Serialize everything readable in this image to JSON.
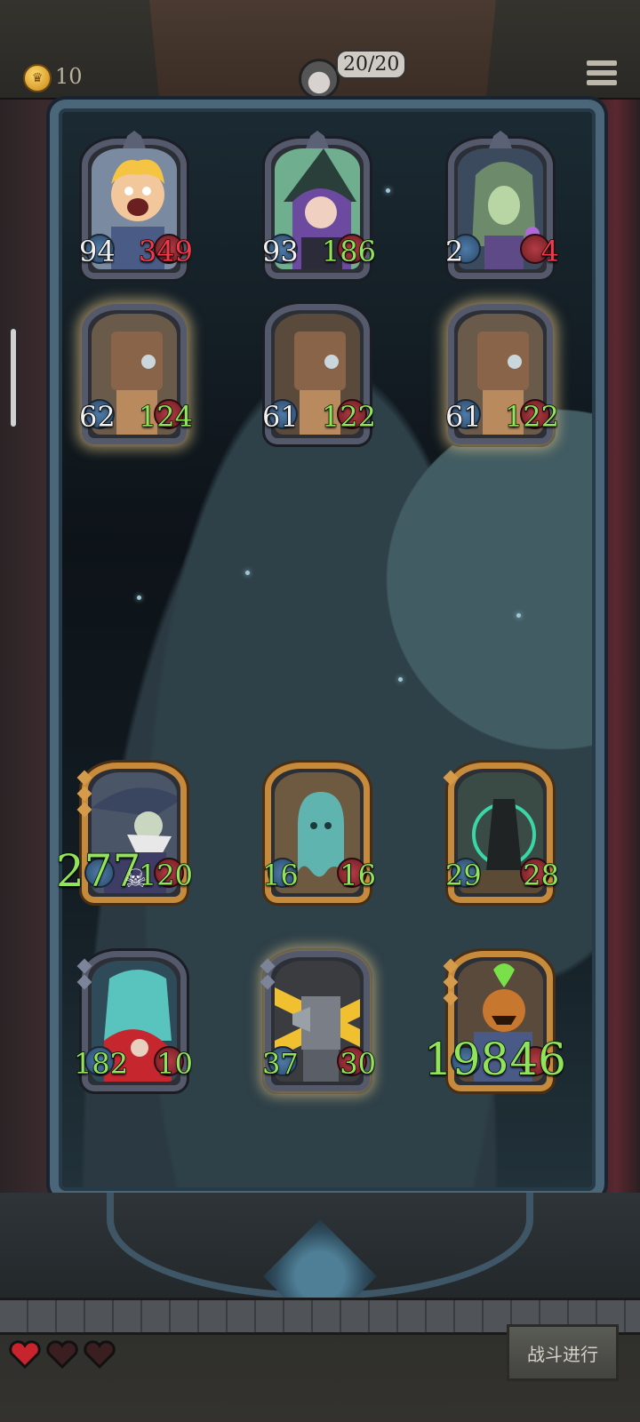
{
  "header": {
    "coins": "10",
    "energy": "20/20",
    "coin_icon": "crown-coin-icon",
    "menu_icon": "hamburger-menu-icon"
  },
  "player_cards": [
    {
      "name": "blonde-boy",
      "attack": "94",
      "health": "349",
      "health_color": "red",
      "glow": false
    },
    {
      "name": "witch",
      "attack": "93",
      "health": "186",
      "health_color": "green",
      "glow": false
    },
    {
      "name": "green-haired-elf",
      "attack": "2",
      "health": "4",
      "health_color": "red",
      "glow": false
    },
    {
      "name": "bucket-head-puppet-1",
      "attack": "62",
      "health": "124",
      "health_color": "green",
      "glow": true
    },
    {
      "name": "bucket-head-puppet-2",
      "attack": "61",
      "health": "122",
      "health_color": "green",
      "glow": false
    },
    {
      "name": "bucket-head-puppet-3",
      "attack": "61",
      "health": "122",
      "health_color": "green",
      "glow": true
    }
  ],
  "enemy_cards": [
    {
      "name": "bearded-wizard",
      "attack": "277",
      "health": "120",
      "attack_color": "green",
      "health_color": "green",
      "glow": false,
      "skull": "skull-icon"
    },
    {
      "name": "teal-ghost",
      "attack": "16",
      "health": "16",
      "attack_color": "green",
      "health_color": "green",
      "glow": false
    },
    {
      "name": "hooded-reaper-boat",
      "attack": "29",
      "health": "28",
      "attack_color": "green",
      "health_color": "green",
      "glow": false
    },
    {
      "name": "spirit-summoner",
      "attack": "182",
      "health": "10",
      "attack_color": "green",
      "health_color": "green",
      "glow": false
    },
    {
      "name": "megaphone-robot",
      "attack": "37",
      "health": "30",
      "attack_color": "green",
      "health_color": "green",
      "glow": true
    },
    {
      "name": "pumpkin-knight",
      "attack": "198",
      "health": "46",
      "attack_color": "green",
      "health_color": "green",
      "glow": false
    }
  ],
  "footer": {
    "lives": 3,
    "heart_icon": "heart-icon",
    "fight_button": "战斗进行"
  },
  "colors": {
    "green_stat": "#8fe45a",
    "red_stat": "#f2394a",
    "board_frame": "#4a6678"
  }
}
